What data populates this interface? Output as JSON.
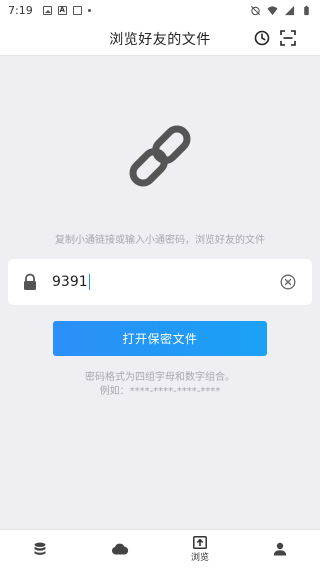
{
  "status_bar": {
    "time": "7:19"
  },
  "header": {
    "title": "浏览好友的文件"
  },
  "hint_text": "复制小通链接或输入小通密码，浏览好友的文件",
  "code_input": {
    "value": "9391"
  },
  "open_button": {
    "label": "打开保密文件"
  },
  "format_note": {
    "line1": "密码格式为四组字母和数字组合。",
    "line2": "例如：****-****-****-****"
  },
  "tabs": [
    {
      "icon": "database-icon",
      "label": ""
    },
    {
      "icon": "cloud-icon",
      "label": ""
    },
    {
      "icon": "browse-icon",
      "label": "浏览",
      "active": true
    },
    {
      "icon": "person-icon",
      "label": ""
    }
  ],
  "colors": {
    "accent": "#2b8ff7",
    "background": "#efeef3",
    "muted_text": "#a8a8b0"
  }
}
